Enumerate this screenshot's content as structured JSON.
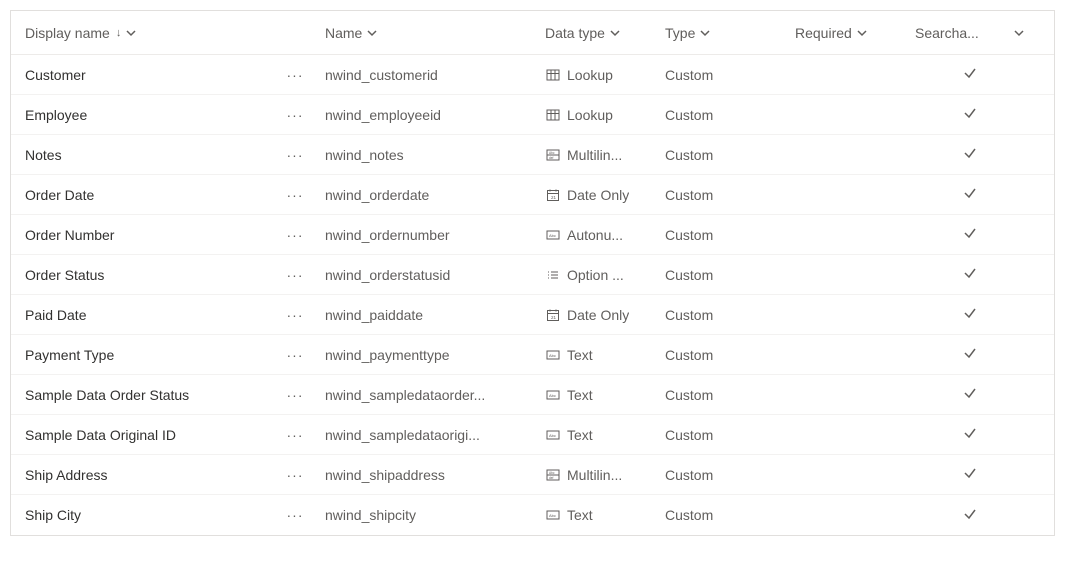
{
  "columns": {
    "display_name": "Display name",
    "name": "Name",
    "data_type": "Data type",
    "type": "Type",
    "required": "Required",
    "searchable": "Searcha..."
  },
  "sort": {
    "column": "display_name",
    "direction": "asc"
  },
  "more_menu_glyph": "···",
  "rows": [
    {
      "display": "Customer",
      "name": "nwind_customerid",
      "dtype_icon": "lookup",
      "dtype": "Lookup",
      "type": "Custom",
      "required": "",
      "searchable": true
    },
    {
      "display": "Employee",
      "name": "nwind_employeeid",
      "dtype_icon": "lookup",
      "dtype": "Lookup",
      "type": "Custom",
      "required": "",
      "searchable": true
    },
    {
      "display": "Notes",
      "name": "nwind_notes",
      "dtype_icon": "multiline",
      "dtype": "Multilin...",
      "type": "Custom",
      "required": "",
      "searchable": true
    },
    {
      "display": "Order Date",
      "name": "nwind_orderdate",
      "dtype_icon": "date",
      "dtype": "Date Only",
      "type": "Custom",
      "required": "",
      "searchable": true
    },
    {
      "display": "Order Number",
      "name": "nwind_ordernumber",
      "dtype_icon": "autonum",
      "dtype": "Autonu...",
      "type": "Custom",
      "required": "",
      "searchable": true
    },
    {
      "display": "Order Status",
      "name": "nwind_orderstatusid",
      "dtype_icon": "optionset",
      "dtype": "Option ...",
      "type": "Custom",
      "required": "",
      "searchable": true
    },
    {
      "display": "Paid Date",
      "name": "nwind_paiddate",
      "dtype_icon": "date",
      "dtype": "Date Only",
      "type": "Custom",
      "required": "",
      "searchable": true
    },
    {
      "display": "Payment Type",
      "name": "nwind_paymenttype",
      "dtype_icon": "text",
      "dtype": "Text",
      "type": "Custom",
      "required": "",
      "searchable": true
    },
    {
      "display": "Sample Data Order Status",
      "name": "nwind_sampledataorder...",
      "dtype_icon": "text",
      "dtype": "Text",
      "type": "Custom",
      "required": "",
      "searchable": true
    },
    {
      "display": "Sample Data Original ID",
      "name": "nwind_sampledataorigi...",
      "dtype_icon": "text",
      "dtype": "Text",
      "type": "Custom",
      "required": "",
      "searchable": true
    },
    {
      "display": "Ship Address",
      "name": "nwind_shipaddress",
      "dtype_icon": "multiline",
      "dtype": "Multilin...",
      "type": "Custom",
      "required": "",
      "searchable": true
    },
    {
      "display": "Ship City",
      "name": "nwind_shipcity",
      "dtype_icon": "text",
      "dtype": "Text",
      "type": "Custom",
      "required": "",
      "searchable": true
    }
  ]
}
